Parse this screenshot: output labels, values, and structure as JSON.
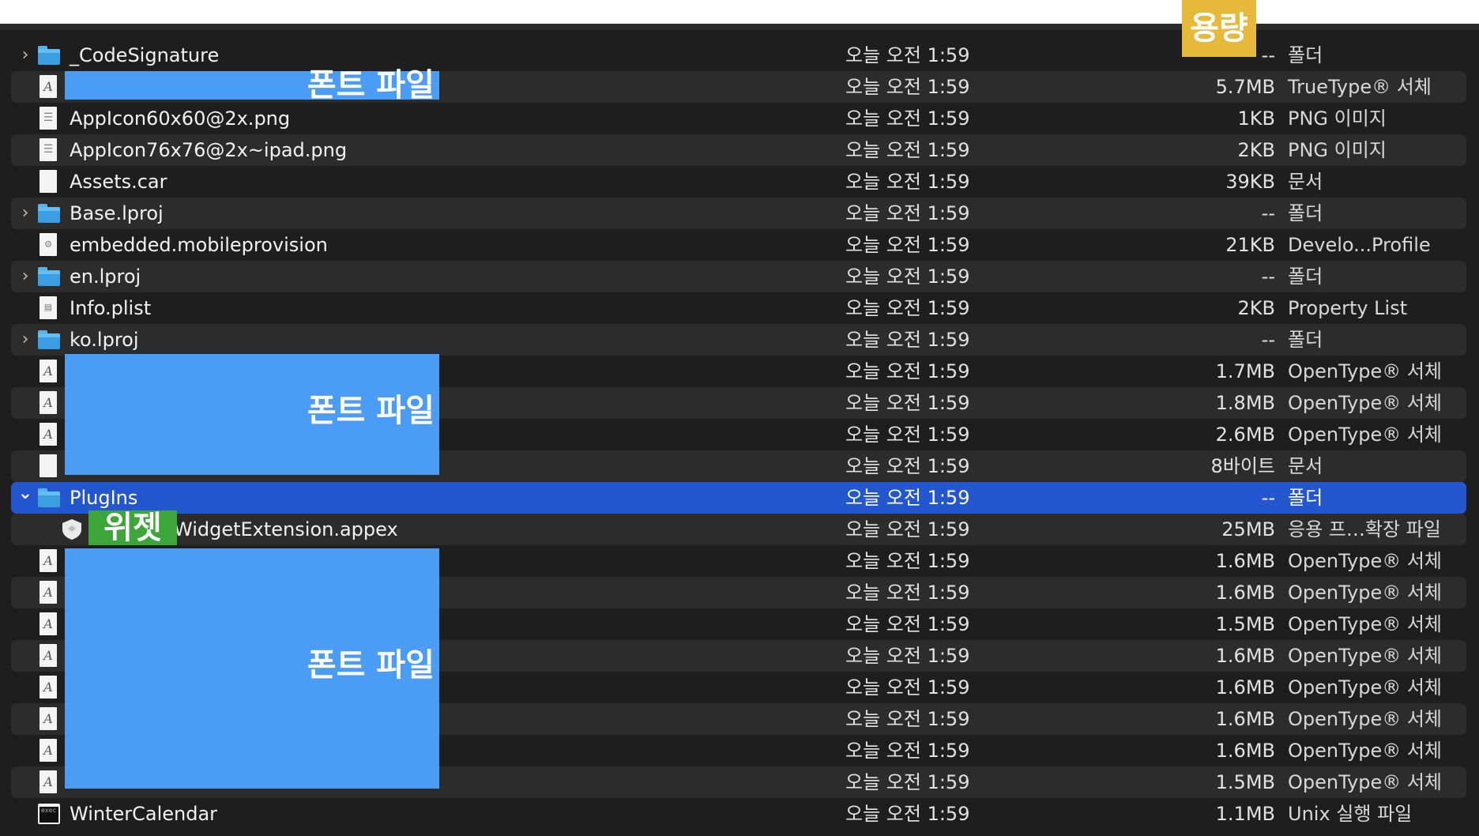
{
  "rows": [
    {
      "name": "_CodeSignature",
      "date": "오늘 오전 1:59",
      "size": "--",
      "kind": "폴더",
      "icon": "folder-icon",
      "expand": "closed"
    },
    {
      "name": "",
      "date": "오늘 오전 1:59",
      "size": "5.7MB",
      "kind": "TrueType® 서체",
      "icon": "font-file-icon"
    },
    {
      "name": "AppIcon60x60@2x.png",
      "date": "오늘 오전 1:59",
      "size": "1KB",
      "kind": "PNG 이미지",
      "icon": "image-file-icon"
    },
    {
      "name": "AppIcon76x76@2x~ipad.png",
      "date": "오늘 오전 1:59",
      "size": "2KB",
      "kind": "PNG 이미지",
      "icon": "image-file-icon"
    },
    {
      "name": "Assets.car",
      "date": "오늘 오전 1:59",
      "size": "39KB",
      "kind": "문서",
      "icon": "document-icon"
    },
    {
      "name": "Base.lproj",
      "date": "오늘 오전 1:59",
      "size": "--",
      "kind": "폴더",
      "icon": "folder-icon",
      "expand": "closed"
    },
    {
      "name": "embedded.mobileprovision",
      "date": "오늘 오전 1:59",
      "size": "21KB",
      "kind": "Develo...Profile",
      "icon": "provision-file-icon"
    },
    {
      "name": "en.lproj",
      "date": "오늘 오전 1:59",
      "size": "--",
      "kind": "폴더",
      "icon": "folder-icon",
      "expand": "closed"
    },
    {
      "name": "Info.plist",
      "date": "오늘 오전 1:59",
      "size": "2KB",
      "kind": "Property List",
      "icon": "plist-file-icon"
    },
    {
      "name": "ko.lproj",
      "date": "오늘 오전 1:59",
      "size": "--",
      "kind": "폴더",
      "icon": "folder-icon",
      "expand": "closed"
    },
    {
      "name": "",
      "date": "오늘 오전 1:59",
      "size": "1.7MB",
      "kind": "OpenType® 서체",
      "icon": "font-file-icon"
    },
    {
      "name": "",
      "date": "오늘 오전 1:59",
      "size": "1.8MB",
      "kind": "OpenType® 서체",
      "icon": "font-file-icon"
    },
    {
      "name": "",
      "date": "오늘 오전 1:59",
      "size": "2.6MB",
      "kind": "OpenType® 서체",
      "icon": "font-file-icon"
    },
    {
      "name": "",
      "date": "오늘 오전 1:59",
      "size": "8바이트",
      "kind": "문서",
      "icon": "document-icon"
    },
    {
      "name": "PlugIns",
      "date": "오늘 오전 1:59",
      "size": "--",
      "kind": "폴더",
      "icon": "folder-icon",
      "expand": "open",
      "selected": true
    },
    {
      "name": "WidgetExtension.appex",
      "date": "오늘 오전 1:59",
      "size": "25MB",
      "kind": "응용 프…확장 파일",
      "icon": "app-extension-icon",
      "indent": true
    },
    {
      "name": "",
      "date": "오늘 오전 1:59",
      "size": "1.6MB",
      "kind": "OpenType® 서체",
      "icon": "font-file-icon"
    },
    {
      "name": "",
      "date": "오늘 오전 1:59",
      "size": "1.6MB",
      "kind": "OpenType® 서체",
      "icon": "font-file-icon"
    },
    {
      "name": "",
      "date": "오늘 오전 1:59",
      "size": "1.5MB",
      "kind": "OpenType® 서체",
      "icon": "font-file-icon"
    },
    {
      "name": "",
      "date": "오늘 오전 1:59",
      "size": "1.6MB",
      "kind": "OpenType® 서체",
      "icon": "font-file-icon"
    },
    {
      "name": "",
      "date": "오늘 오전 1:59",
      "size": "1.6MB",
      "kind": "OpenType® 서체",
      "icon": "font-file-icon"
    },
    {
      "name": "",
      "date": "오늘 오전 1:59",
      "size": "1.6MB",
      "kind": "OpenType® 서체",
      "icon": "font-file-icon"
    },
    {
      "name": "",
      "date": "오늘 오전 1:59",
      "size": "1.6MB",
      "kind": "OpenType® 서체",
      "icon": "font-file-icon"
    },
    {
      "name": "",
      "date": "오늘 오전 1:59",
      "size": "1.5MB",
      "kind": "OpenType® 서체",
      "icon": "font-file-icon"
    },
    {
      "name": "WinterCalendar",
      "date": "오늘 오전 1:59",
      "size": "1.1MB",
      "kind": "Unix 실행 파일",
      "icon": "executable-icon"
    }
  ],
  "annotations": {
    "font_label_1": "폰트 파일",
    "font_label_2": "폰트 파일",
    "font_label_3": "폰트 파일",
    "widget_label": "위젯",
    "size_label": "용량"
  },
  "colors": {
    "background": "#1e1e1e",
    "row_alt": "#2c2c2c",
    "selection": "#2456d0",
    "folder": "#3a9ee0",
    "overlay_blue": "#4a9cf5",
    "overlay_green": "#3da63a",
    "overlay_yellow": "#e7b93a"
  }
}
